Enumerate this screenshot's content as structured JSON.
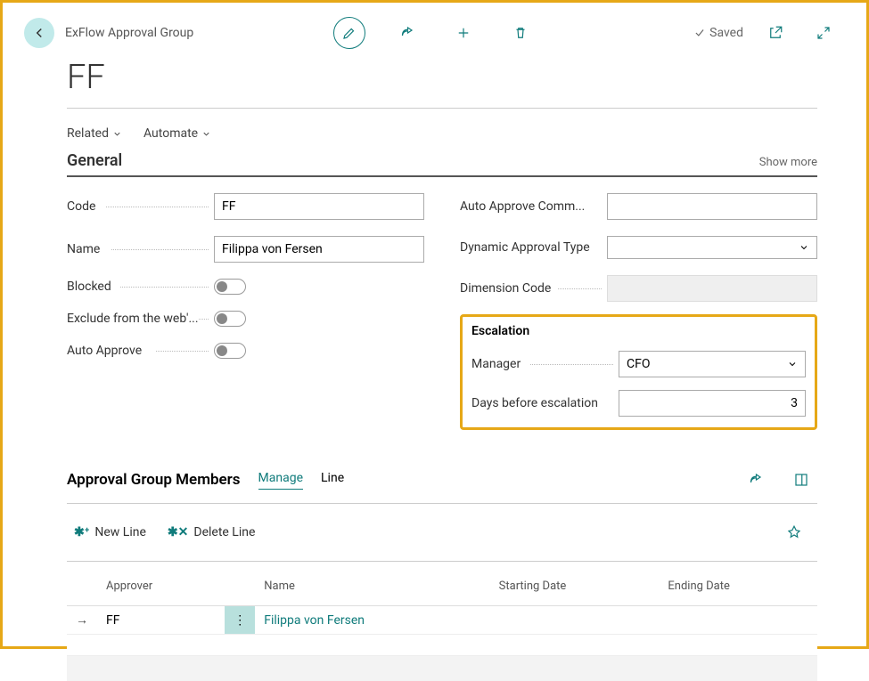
{
  "header": {
    "breadcrumb": "ExFlow Approval Group",
    "saved_label": "Saved"
  },
  "page_title": "FF",
  "menu": {
    "related": "Related",
    "automate": "Automate"
  },
  "sections": {
    "general": {
      "title": "General",
      "show_more": "Show more",
      "fields": {
        "code": {
          "label": "Code",
          "value": "FF"
        },
        "name": {
          "label": "Name",
          "value": "Filippa von Fersen"
        },
        "blocked": {
          "label": "Blocked",
          "value": false
        },
        "exclude_web": {
          "label": "Exclude from the web'...",
          "value": false
        },
        "auto_approve": {
          "label": "Auto Approve",
          "value": false
        },
        "auto_approve_comm": {
          "label": "Auto Approve Comm...",
          "value": ""
        },
        "dynamic_type": {
          "label": "Dynamic Approval Type",
          "value": ""
        },
        "dimension_code": {
          "label": "Dimension Code",
          "value": ""
        }
      }
    },
    "escalation": {
      "title": "Escalation",
      "manager": {
        "label": "Manager",
        "value": "CFO"
      },
      "days": {
        "label": "Days before escalation",
        "value": "3"
      }
    }
  },
  "members": {
    "title": "Approval Group Members",
    "tabs": {
      "manage": "Manage",
      "line": "Line"
    },
    "toolbar": {
      "new_line": "New Line",
      "delete_line": "Delete Line"
    },
    "columns": {
      "approver": "Approver",
      "name": "Name",
      "start": "Starting Date",
      "end": "Ending Date"
    },
    "rows": [
      {
        "approver": "FF",
        "name": "Filippa von Fersen",
        "start": "",
        "end": ""
      }
    ]
  }
}
